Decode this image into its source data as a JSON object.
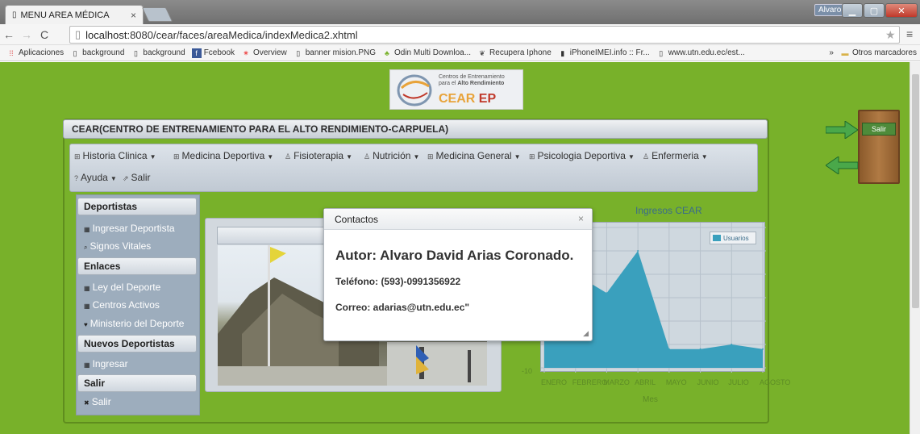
{
  "browser": {
    "tab_title": "MENU AREA MÉDICA",
    "tab_close": "×",
    "user_badge": "Alvaro",
    "url_host": "localhost",
    "url_path": ":8080/cear/faces/areaMedica/indexMedica2.xhtml",
    "bookmarks": [
      {
        "label": "Aplicaciones",
        "icon": "apps-icon"
      },
      {
        "label": "background",
        "icon": "page-icon"
      },
      {
        "label": "background",
        "icon": "page-icon"
      },
      {
        "label": "Fcebook",
        "icon": "facebook-icon"
      },
      {
        "label": "Overview",
        "icon": "overview-icon"
      },
      {
        "label": "banner mision.PNG",
        "icon": "page-icon"
      },
      {
        "label": "Odin Multi Downloa...",
        "icon": "android-icon"
      },
      {
        "label": "Recupera Iphone",
        "icon": "bird-icon"
      },
      {
        "label": "iPhoneIMEI.info :: Fr...",
        "icon": "phone-icon"
      },
      {
        "label": "www.utn.edu.ec/est...",
        "icon": "page-icon"
      }
    ],
    "other_bookmarks": "Otros marcadores",
    "more_bookmarks": "»"
  },
  "logo": {
    "line1": "Centros de Entrenamiento",
    "line2": "para el",
    "line2_bold": "Alto Rendimiento",
    "brand": "CEAR",
    "brand_ep": "EP"
  },
  "panel": {
    "title": "CEAR(CENTRO DE ENTRENAMIENTO PARA EL ALTO RENDIMIENTO-CARPUELA)"
  },
  "menu": {
    "items": [
      "Historia Clinica",
      "Medicina Deportiva",
      "Fisioterapia",
      "Nutrición",
      "Medicina General",
      "Psicologia Deportiva",
      "Enfermeria",
      "Ayuda",
      "Salir"
    ]
  },
  "sidebar": {
    "section1": "Deportistas",
    "item1": "Ingresar Deportista",
    "item2": "Signos Vitales",
    "section2": "Enlaces",
    "item3": "Ley del Deporte",
    "item4": "Centros Activos",
    "item5": "Ministerio del Deporte",
    "section3": "Nuevos Deportistas",
    "item6": "Ingresar",
    "section4": "Salir",
    "item7": "Salir"
  },
  "chart_data": {
    "type": "area",
    "title": "Ingresos CEAR",
    "xlabel": "Mes",
    "categories": [
      "ENERO",
      "FEBRERO",
      "MARZO",
      "ABRIL",
      "MAYO",
      "JUNIO",
      "JULIO",
      "AGOSTO"
    ],
    "series": [
      {
        "name": "Usuarios",
        "values": [
          40,
          30,
          22,
          40,
          -2,
          -2,
          0,
          -2
        ]
      }
    ],
    "ymin_label": "-10",
    "color": "#3aa0bd"
  },
  "dialog": {
    "title": "Contactos",
    "close": "×",
    "author": "Autor: Alvaro David Arias Coronado.",
    "phone": "Teléfono: (593)-0991356922",
    "email": "Correo: adarias@utn.edu.ec\""
  },
  "door": {
    "button": "Salir"
  },
  "colors": {
    "page_bg": "#78b12a",
    "chart_fill": "#3aa0bd"
  }
}
